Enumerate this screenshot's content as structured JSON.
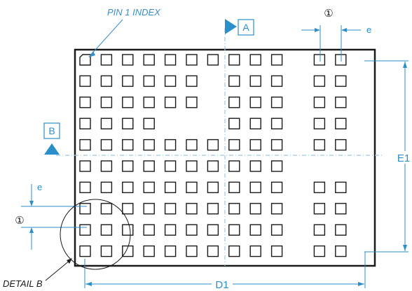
{
  "labels": {
    "pin1_index": "PIN 1 INDEX",
    "datum_a": "A",
    "datum_b": "B",
    "pitch_e_top": "e",
    "pitch_e_left": "e",
    "note_top": "①",
    "note_left": "①",
    "dim_e1": "E1",
    "dim_d1": "D1",
    "detail_b": "DETAIL B"
  },
  "grid": {
    "columns": 13,
    "rows": 10,
    "empty_pads": [
      [
        1,
        6
      ],
      [
        2,
        6
      ],
      [
        3,
        4
      ],
      [
        3,
        5
      ],
      [
        3,
        6
      ]
    ],
    "depopulated_columns": [
      10
    ]
  },
  "colors": {
    "outline": "#1a1a1a",
    "dimension": "#2b8fc9",
    "centerline": "#9cc9e6",
    "label_italic": "#3a8fc7"
  }
}
